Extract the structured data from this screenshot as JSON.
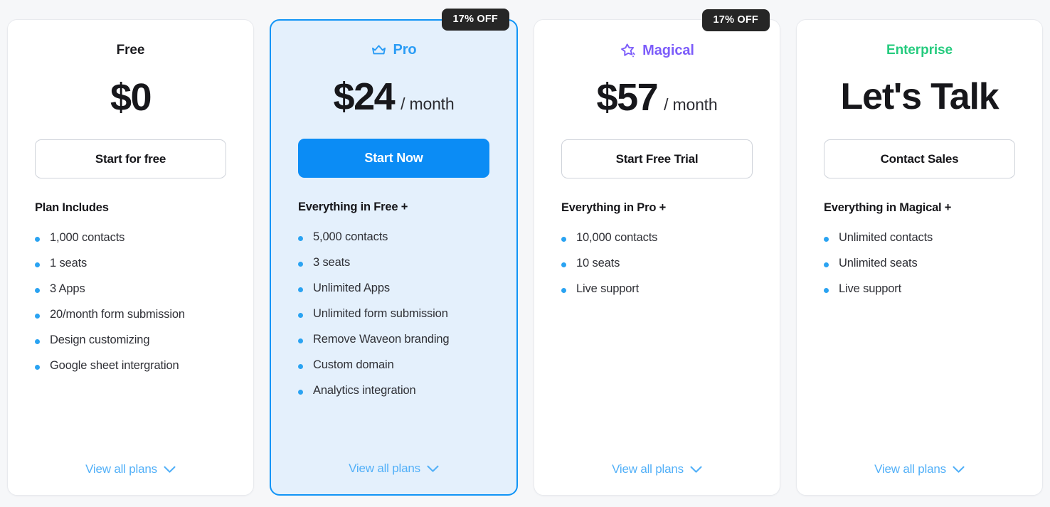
{
  "colors": {
    "page_background": "#f6f7f9",
    "accent_blue": "#0b8cf5",
    "link_blue": "#52b0f8",
    "bullet_blue": "#2aa3f2",
    "pro_purple": "#7c5cfa",
    "enterprise_green": "#25cb7e",
    "badge_dark": "#262626",
    "featured_card_bg": "#e4f0fc"
  },
  "plans": [
    {
      "id": "free",
      "name": "Free",
      "icon": null,
      "badge": null,
      "price": "$0",
      "period": null,
      "cta": "Start for free",
      "cta_style": "outline",
      "features_title": "Plan Includes",
      "features": [
        "1,000 contacts",
        "1 seats",
        "3 Apps",
        "20/month form submission",
        "Design customizing",
        "Google sheet intergration"
      ],
      "footer_link": "View all plans"
    },
    {
      "id": "pro",
      "name": "Pro",
      "icon": "crown-icon",
      "badge": "17% OFF",
      "price": "$24",
      "period": "/ month",
      "cta": "Start Now",
      "cta_style": "primary",
      "features_title": "Everything in Free +",
      "features": [
        "5,000 contacts",
        "3 seats",
        "Unlimited Apps",
        "Unlimited form submission",
        "Remove Waveon branding",
        "Custom domain",
        "Analytics integration"
      ],
      "footer_link": "View all plans"
    },
    {
      "id": "magical",
      "name": "Magical",
      "icon": "sparkle-star-icon",
      "badge": "17% OFF",
      "price": "$57",
      "period": "/ month",
      "cta": "Start Free Trial",
      "cta_style": "outline",
      "features_title": "Everything in Pro +",
      "features": [
        "10,000 contacts",
        "10 seats",
        "Live support"
      ],
      "footer_link": "View all plans"
    },
    {
      "id": "enterprise",
      "name": "Enterprise",
      "icon": null,
      "badge": null,
      "price": "Let's Talk",
      "period": null,
      "cta": "Contact Sales",
      "cta_style": "outline",
      "features_title": "Everything in Magical +",
      "features": [
        "Unlimited contacts",
        "Unlimited seats",
        "Live support"
      ],
      "footer_link": "View all plans"
    }
  ]
}
